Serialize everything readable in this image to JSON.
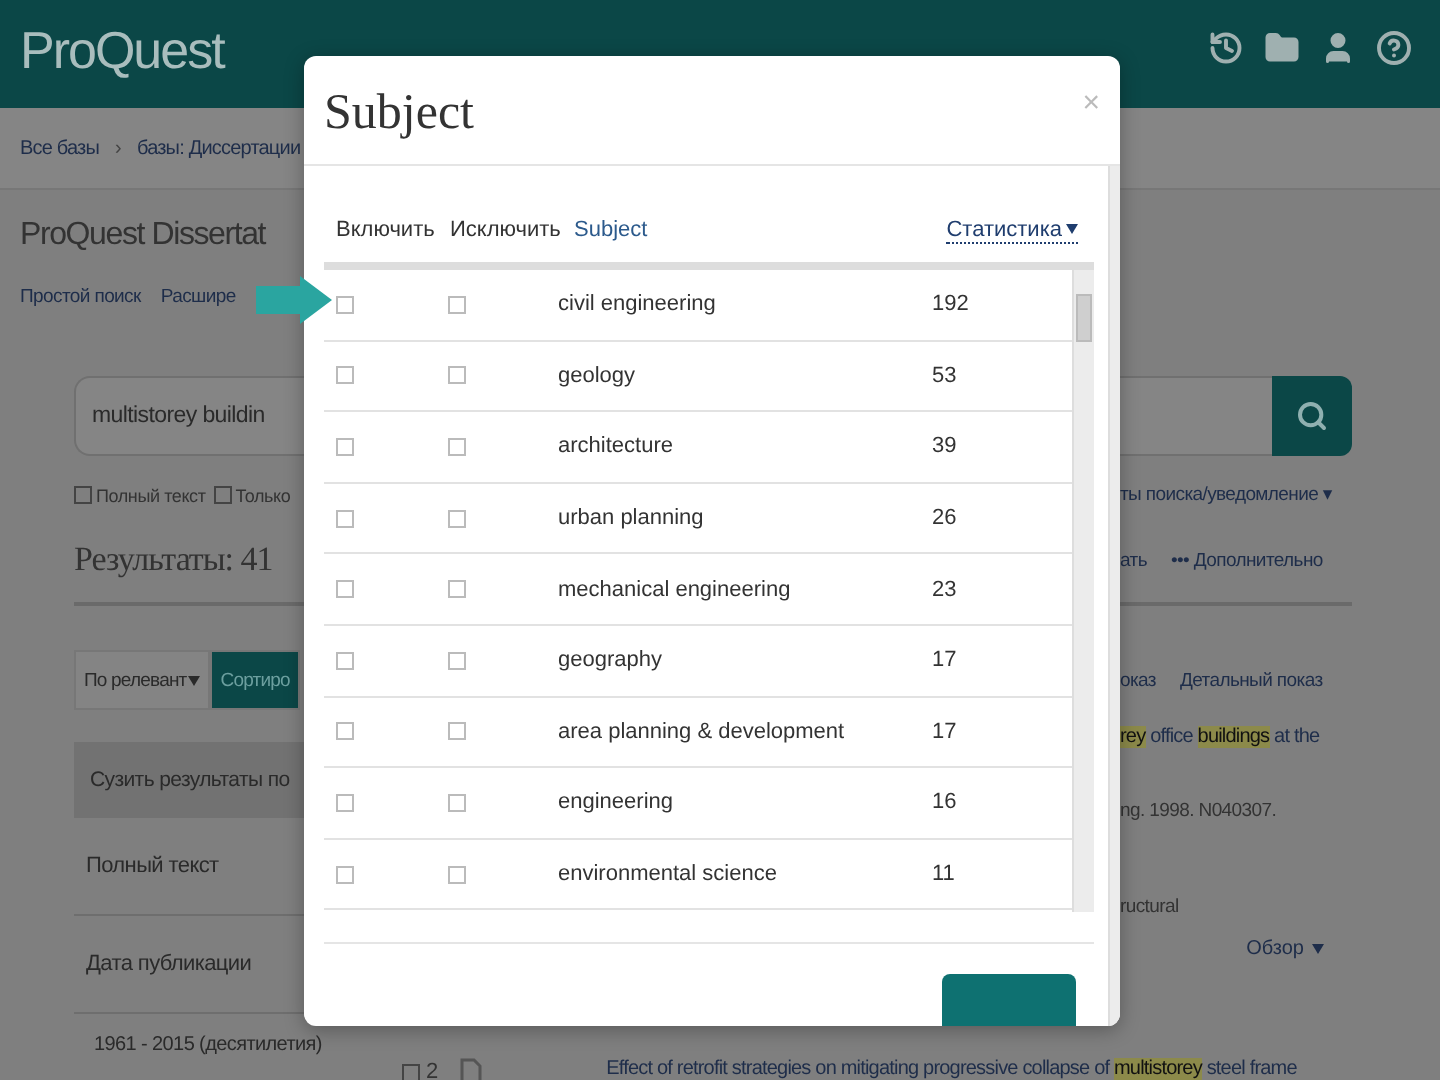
{
  "header": {
    "logo": "ProQuest"
  },
  "breadcrumb": {
    "items": [
      "Все базы",
      "базы: Диссертации"
    ],
    "separator": "›"
  },
  "page_title": "ProQuest Dissertat",
  "search_links": [
    "Простой поиск",
    "Расшире"
  ],
  "search": {
    "value": "multistorey buildin"
  },
  "filters": [
    {
      "label": "Полный текст",
      "checked": false
    },
    {
      "label": "Только",
      "checked": false
    }
  ],
  "alert_link": "ты поиска/уведомление ▾",
  "results_title": "Результаты: 41",
  "actions": [
    "ать",
    "••• Дополнительно"
  ],
  "sort": [
    {
      "label": "По релевант",
      "selected": false
    },
    {
      "label": "Сортиро",
      "selected": true
    }
  ],
  "view_links": [
    "оказ",
    "Детальный показ"
  ],
  "narrow": {
    "title": "Сузить результаты по",
    "sections": [
      "Полный текст",
      "Дата публикации"
    ],
    "range": "1961 - 2015 (десятилетия)"
  },
  "result1": {
    "title": [
      {
        "text": "rey",
        "highlight": true
      },
      {
        "text": " office ",
        "highlight": false
      },
      {
        "text": "buildings",
        "highlight": true
      },
      {
        "text": " at the",
        "highlight": false
      }
    ],
    "meta": "ng. 1998. N040307.",
    "snippet": "ructural",
    "overview": "Обзор"
  },
  "result2": {
    "number": "2",
    "checked": false,
    "title": [
      {
        "text": "Effect of retrofit strategies on mitigating progressive collapse of ",
        "highlight": false
      },
      {
        "text": "multistorey",
        "highlight": true
      },
      {
        "text": " steel frame",
        "highlight": false
      }
    ]
  },
  "modal": {
    "title": "Subject",
    "close": "×",
    "columns": [
      "Включить",
      "Исключить",
      "Subject",
      "Статистика"
    ],
    "rows": [
      {
        "subject": "civil engineering",
        "count": "192",
        "include": false,
        "exclude": false
      },
      {
        "subject": "geology",
        "count": "53",
        "include": false,
        "exclude": false
      },
      {
        "subject": "architecture",
        "count": "39",
        "include": false,
        "exclude": false
      },
      {
        "subject": "urban planning",
        "count": "26",
        "include": false,
        "exclude": false
      },
      {
        "subject": "mechanical engineering",
        "count": "23",
        "include": false,
        "exclude": false
      },
      {
        "subject": "geography",
        "count": "17",
        "include": false,
        "exclude": false
      },
      {
        "subject": "area planning & development",
        "count": "17",
        "include": false,
        "exclude": false
      },
      {
        "subject": "engineering",
        "count": "16",
        "include": false,
        "exclude": false
      },
      {
        "subject": "environmental science",
        "count": "11",
        "include": false,
        "exclude": false
      }
    ]
  }
}
